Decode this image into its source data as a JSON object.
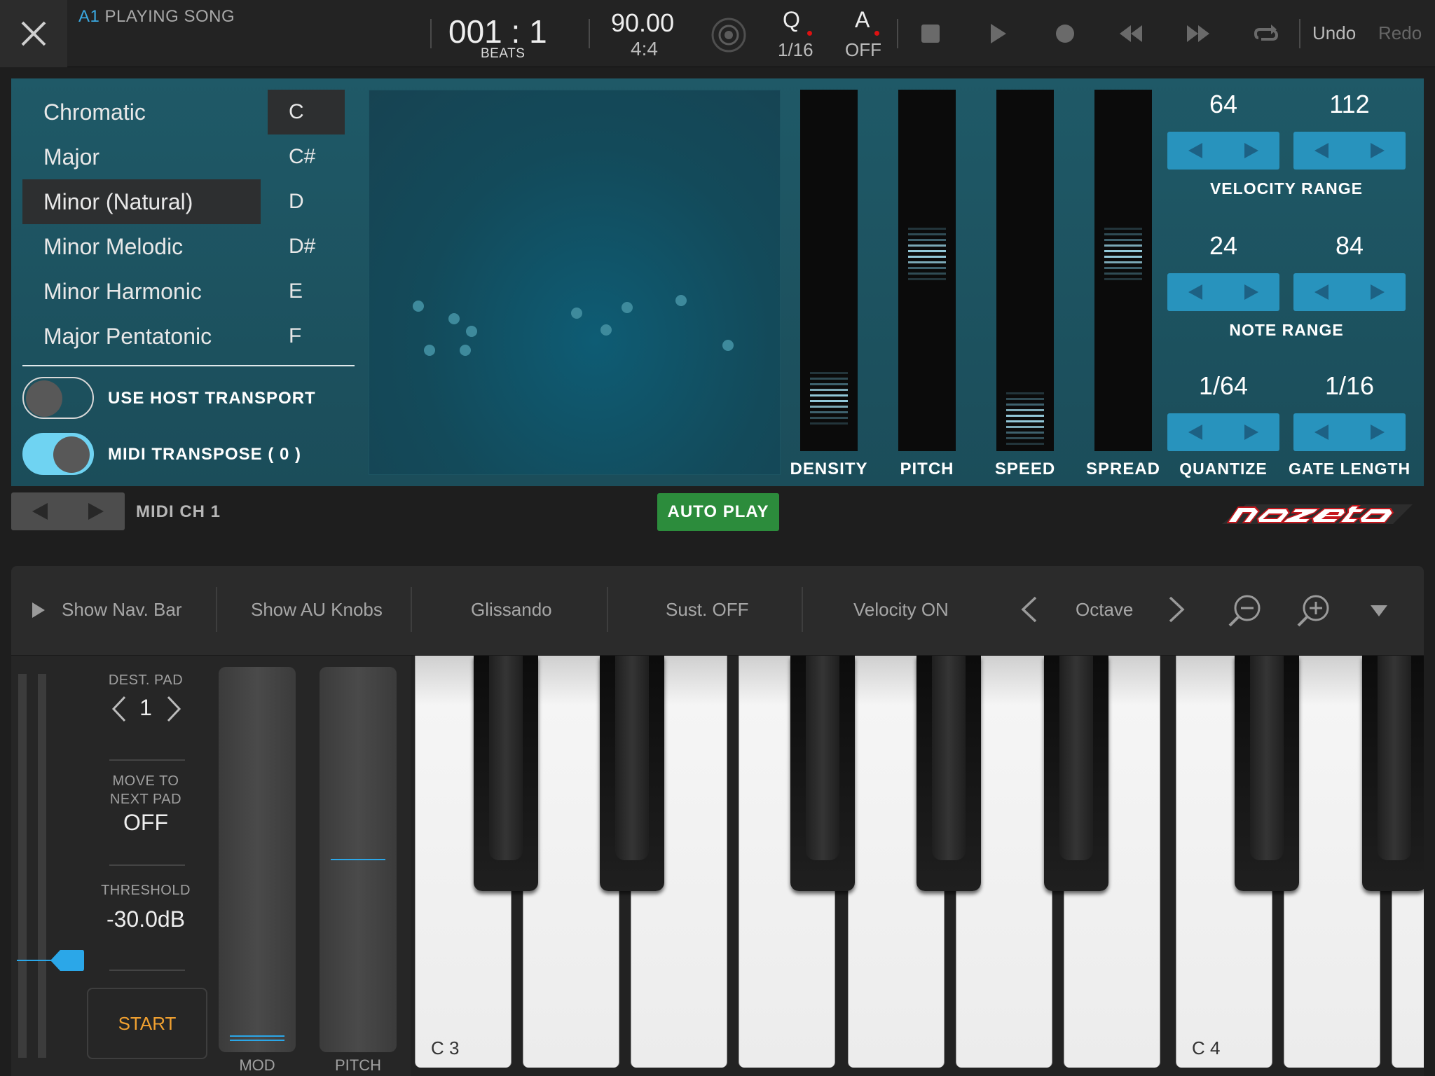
{
  "header": {
    "slot": "A1",
    "song_status": "PLAYING SONG",
    "position": "001 : 1",
    "position_unit": "BEATS",
    "tempo": "90.00",
    "time_signature": "4:4",
    "quantize_label": "Q",
    "quantize_value": "1/16",
    "auto_label": "A",
    "auto_value": "OFF",
    "undo": "Undo",
    "redo": "Redo"
  },
  "scales": [
    {
      "label": "Chromatic",
      "selected": false
    },
    {
      "label": "Major",
      "selected": false
    },
    {
      "label": "Minor (Natural)",
      "selected": true
    },
    {
      "label": "Minor Melodic",
      "selected": false
    },
    {
      "label": "Minor Harmonic",
      "selected": false
    },
    {
      "label": "Major Pentatonic",
      "selected": false
    }
  ],
  "keys": [
    {
      "label": "C",
      "selected": true
    },
    {
      "label": "C#",
      "selected": false
    },
    {
      "label": "D",
      "selected": false
    },
    {
      "label": "D#",
      "selected": false
    },
    {
      "label": "E",
      "selected": false
    },
    {
      "label": "F",
      "selected": false
    }
  ],
  "toggles": {
    "host_transport": {
      "label": "USE HOST TRANSPORT",
      "on": false
    },
    "midi_transpose": {
      "label": "MIDI TRANSPOSE  ( 0 )",
      "on": true
    }
  },
  "meters": {
    "density": {
      "label": "DENSITY",
      "level": 0.18
    },
    "pitch": {
      "label": "PITCH",
      "level": 0.58
    },
    "speed": {
      "label": "SPEED",
      "level": 0.12
    },
    "spread": {
      "label": "SPREAD",
      "level": 0.58
    }
  },
  "ranges": {
    "velocity": {
      "label": "VELOCITY RANGE",
      "low": "64",
      "high": "112"
    },
    "note": {
      "label": "NOTE RANGE",
      "low": "24",
      "high": "84"
    },
    "quantize": {
      "label": "QUANTIZE",
      "value": "1/64"
    },
    "gate": {
      "label": "GATE LENGTH",
      "value": "1/16"
    }
  },
  "midi_channel": "MIDI CH 1",
  "auto_play": "AUTO PLAY",
  "brand": "nozeta",
  "colors": {
    "accent_blue": "#2893bd",
    "autoplay_green": "#2c8c3c",
    "toggle_on": "#6fd3f2",
    "start_orange": "#f0a030",
    "slot_blue": "#3aa8e0"
  },
  "keyboard_toolbar": {
    "nav_bar": "Show Nav. Bar",
    "au_knobs": "Show AU Knobs",
    "glissando": "Glissando",
    "sustain": "Sust. OFF",
    "velocity": "Velocity ON",
    "octave": "Octave"
  },
  "pad_controls": {
    "dest_pad_label": "DEST. PAD",
    "dest_pad_value": "1",
    "move_label_1": "MOVE TO",
    "move_label_2": "NEXT PAD",
    "move_value": "OFF",
    "threshold_label": "THRESHOLD",
    "threshold_value": "-30.0dB",
    "start": "START"
  },
  "wheels": {
    "mod": "MOD",
    "pitch": "PITCH"
  },
  "piano_labels": {
    "c3": "C 3",
    "c4": "C 4"
  }
}
